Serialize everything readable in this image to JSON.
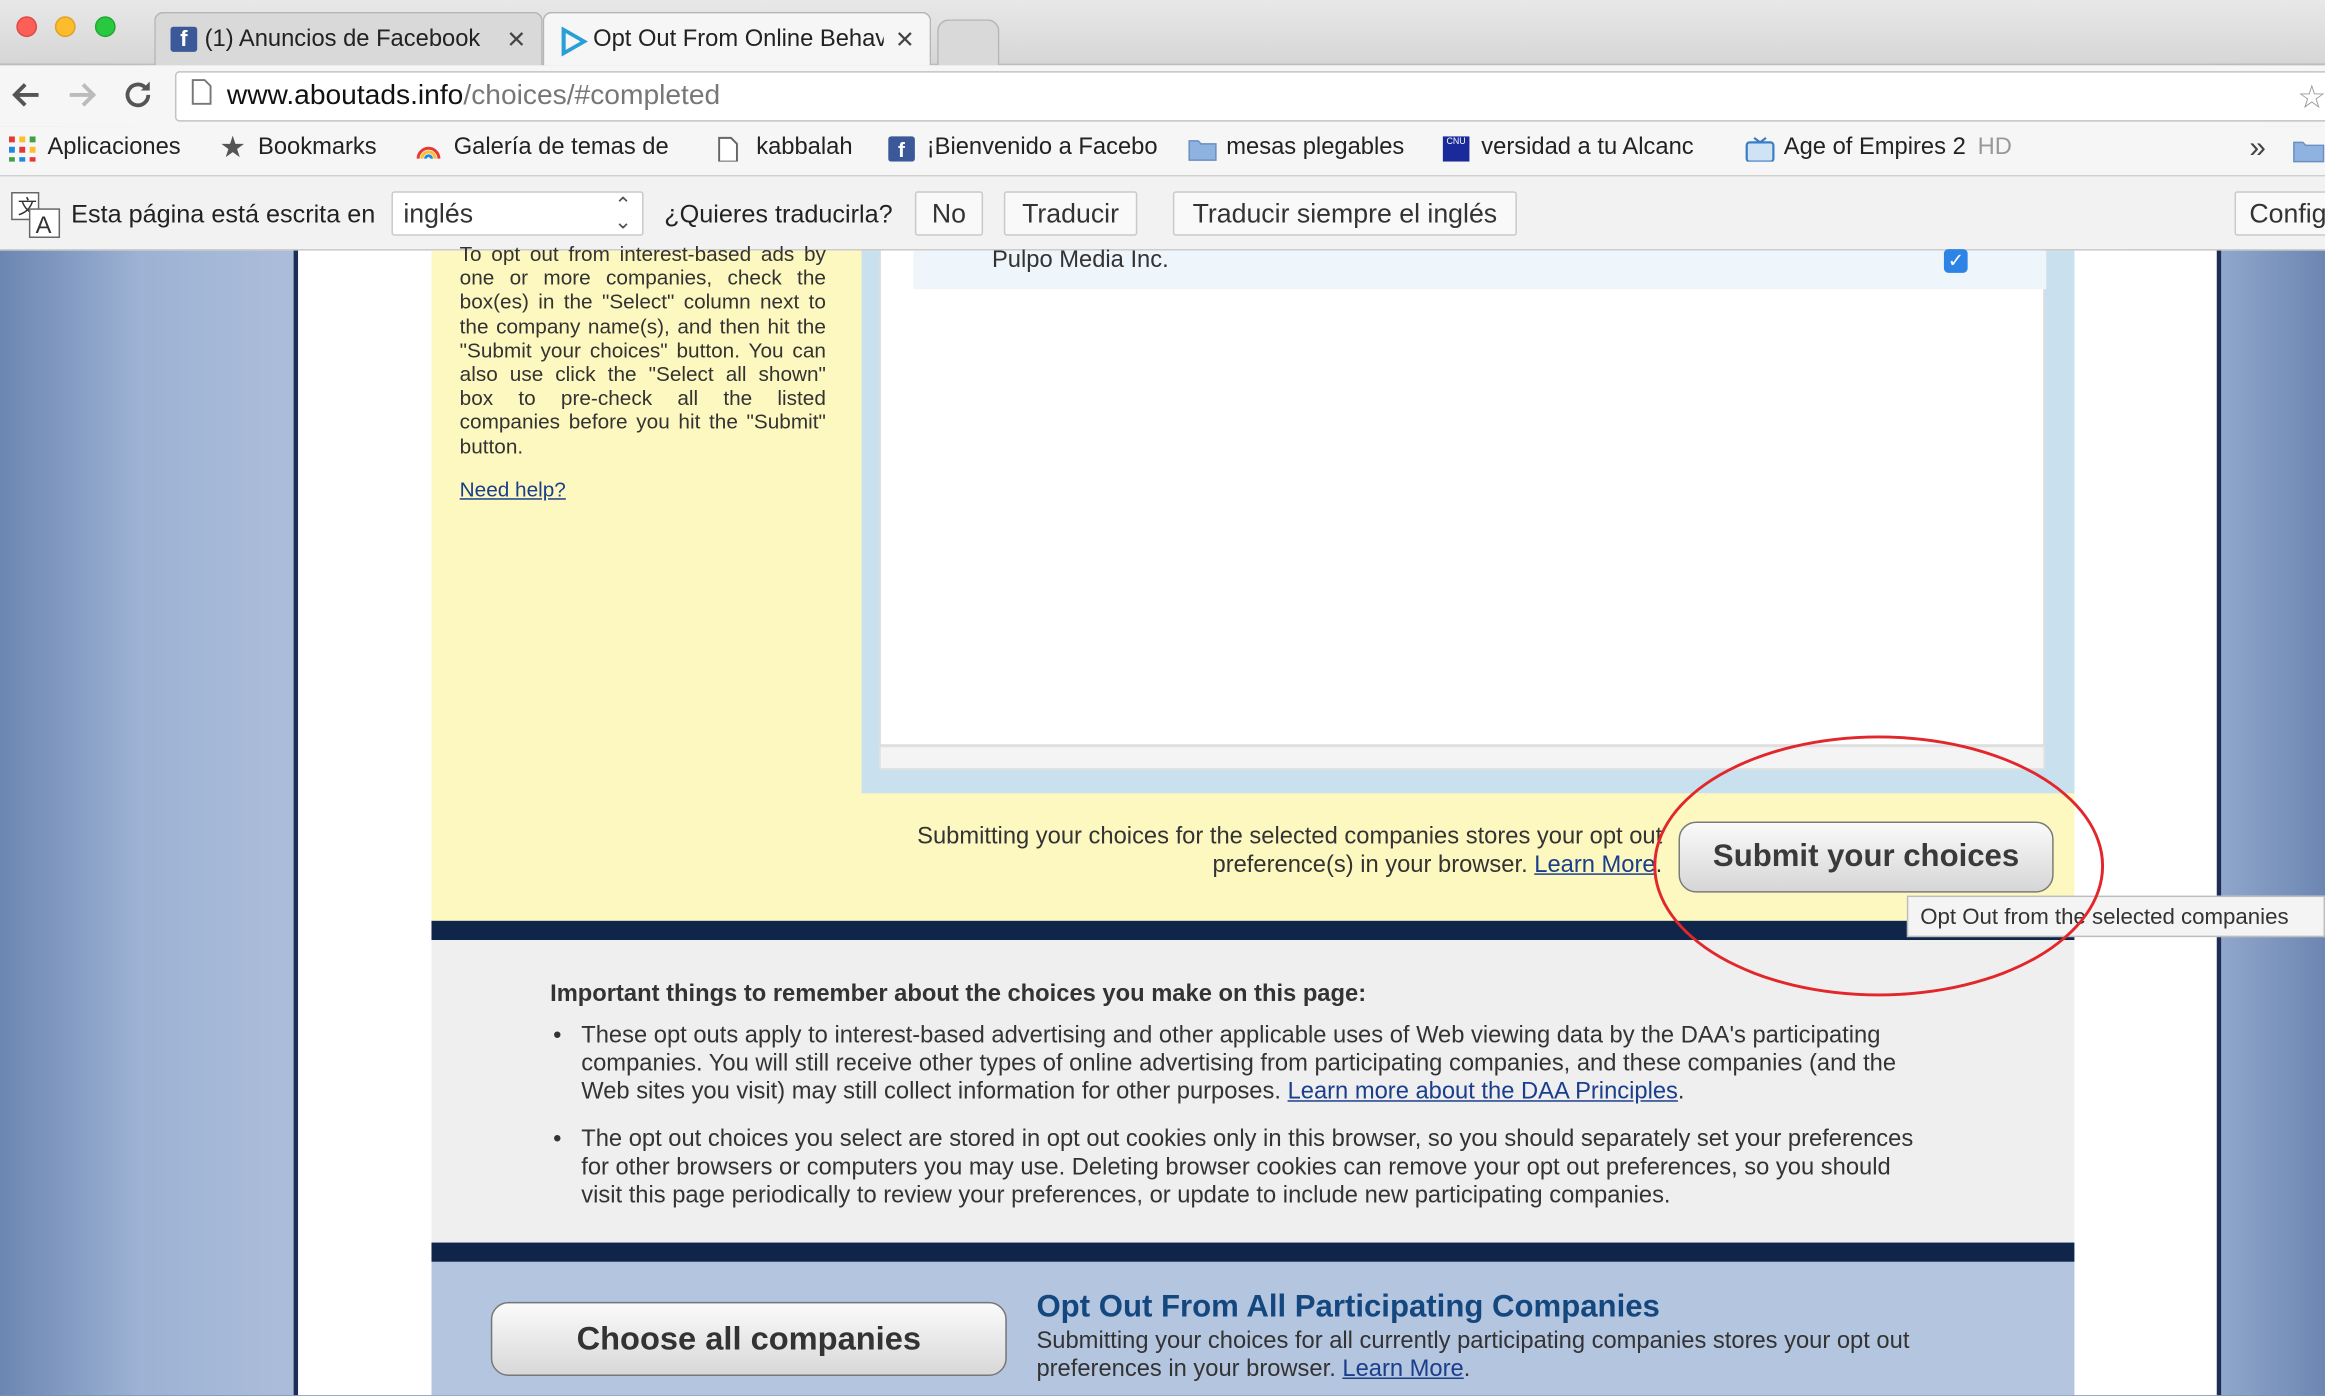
{
  "browser": {
    "tabs": [
      {
        "title": "(1) Anuncios de Facebook",
        "icon": "facebook-icon"
      },
      {
        "title": "Opt Out From Online Behav",
        "icon": "daa-icon"
      }
    ],
    "url_domain": "www.aboutads.info",
    "url_path": "/choices/#completed",
    "bookmarks": [
      {
        "label": "Aplicaciones",
        "icon": "apps-grid-icon"
      },
      {
        "label": "Bookmarks",
        "icon": "star-icon"
      },
      {
        "label": "Galería de temas de",
        "icon": "rainbow-icon"
      },
      {
        "label": "kabbalah",
        "icon": "page-icon"
      },
      {
        "label": "¡Bienvenido a Facebo",
        "icon": "facebook-icon"
      },
      {
        "label": "mesas plegables",
        "icon": "folder-icon"
      },
      {
        "label": "versidad a tu Alcanc",
        "icon": "site-icon"
      },
      {
        "label": "Age of Empires 2",
        "suffix": "HD",
        "icon": "tv-icon"
      }
    ],
    "bookmarks_overflow": "»",
    "translate": {
      "prompt": "Esta página está escrita en",
      "language": "inglés",
      "question": "¿Quieres traducirla?",
      "no_label": "No",
      "translate_label": "Traducir",
      "always_label": "Traducir siempre el inglés",
      "config_label": "Config"
    }
  },
  "page": {
    "instructions": "To opt out from interest-based ads by one or more companies, check the box(es) in the \"Select\" column next to the company name(s), and then hit the \"Submit your choices\" button. You can also use click the \"Select all shown\" box to pre-check all the listed companies before you hit the \"Submit\" button.",
    "need_help": "Need help?",
    "company_row": {
      "name": "Pulpo Media Inc.",
      "checked": true
    },
    "submit_text": "Submitting your choices for the selected companies stores your opt out preference(s) in your browser.",
    "learn_more": "Learn More",
    "submit_button": "Submit your choices",
    "tooltip": "Opt Out from the selected companies",
    "important_heading": "Important things to remember about the choices you make on this page:",
    "bullet1": "These opt outs apply to interest-based advertising and other applicable uses of Web viewing data by the DAA's participating companies. You will still receive other types of online advertising from participating companies, and these companies (and the Web sites you visit) may still collect information for other purposes.",
    "bullet1_link": "Learn more about the DAA Principles",
    "bullet2": "The opt out choices you select are stored in opt out cookies only in this browser, so you should separately set your preferences for other browsers or computers you may use. Deleting browser cookies can remove your opt out preferences, so you should visit this page periodically to review your preferences, or update to include new participating companies.",
    "choose_all_button": "Choose all companies",
    "opt_out_all_heading": "Opt Out From All Participating Companies",
    "opt_out_all_text": "Submitting your choices for all currently participating companies stores your opt out preferences in your browser."
  },
  "colors": {
    "annotation_circle": "#e2272b",
    "link": "#1a3e8c",
    "heading_blue": "#15477f",
    "navy_band": "#0f2549"
  }
}
